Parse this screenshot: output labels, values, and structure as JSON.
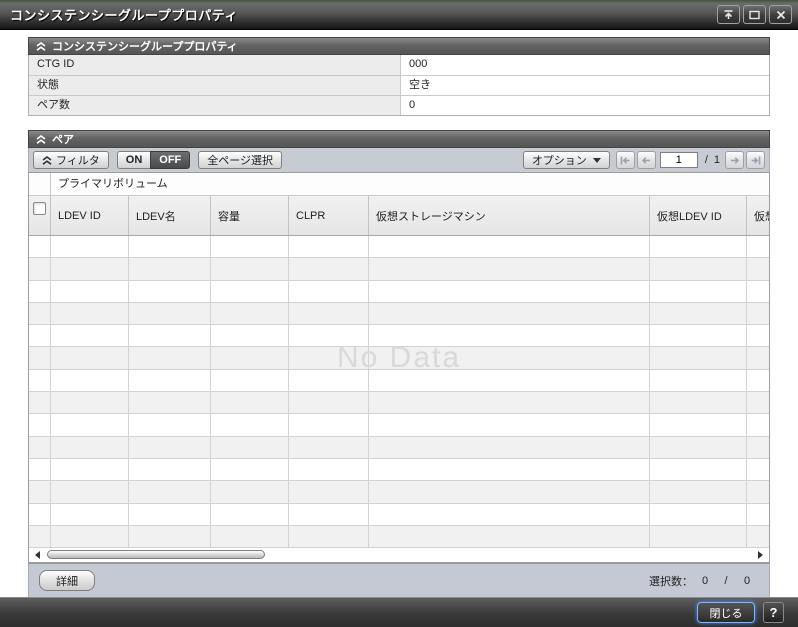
{
  "window": {
    "title": "コンシステンシーグループプロパティ"
  },
  "icons": {
    "titlebar": [
      "rollup-icon",
      "maximize-icon",
      "close-icon"
    ],
    "section_collapse": "double-chevron-up",
    "options_dropdown": "triangle-down"
  },
  "properties_section": {
    "title": "コンシステンシーグループプロパティ",
    "rows": [
      {
        "label": "CTG ID",
        "value": "000"
      },
      {
        "label": "状態",
        "value": "空き"
      },
      {
        "label": "ペア数",
        "value": "0"
      }
    ]
  },
  "pair_section": {
    "title": "ペア",
    "toolbar": {
      "filter_label": "フィルタ",
      "on_label": "ON",
      "off_label": "OFF",
      "filter_state": "OFF",
      "select_all_pages_label": "全ページ選択",
      "options_label": "オプション",
      "page_current": "1",
      "page_separator": "/",
      "page_total": "1"
    },
    "table": {
      "group_header": "プライマリボリューム",
      "columns": [
        "LDEV ID",
        "LDEV名",
        "容量",
        "CLPR",
        "仮想ストレージマシン",
        "仮想LDEV ID",
        "仮想デバイス名"
      ],
      "empty_message": "No Data",
      "empty_row_count": 14
    },
    "footer": {
      "detail_button_label": "詳細",
      "selected_count_label": "選択数：",
      "selected_current": "0",
      "selected_separator": "/",
      "selected_total": "0"
    }
  },
  "bottom_bar": {
    "close_button_label": "閉じる",
    "help_button_label": "?"
  },
  "colors": {
    "focus_accent": "#3f8cff",
    "titlebar_dark": "#2b2b2b",
    "section_header": "#636363",
    "toolbar_bg": "#c7cbd2",
    "footer_bg": "#c5c9d4",
    "row_alt": "#f1f1f1",
    "no_data_text": "#d9d9d9"
  }
}
